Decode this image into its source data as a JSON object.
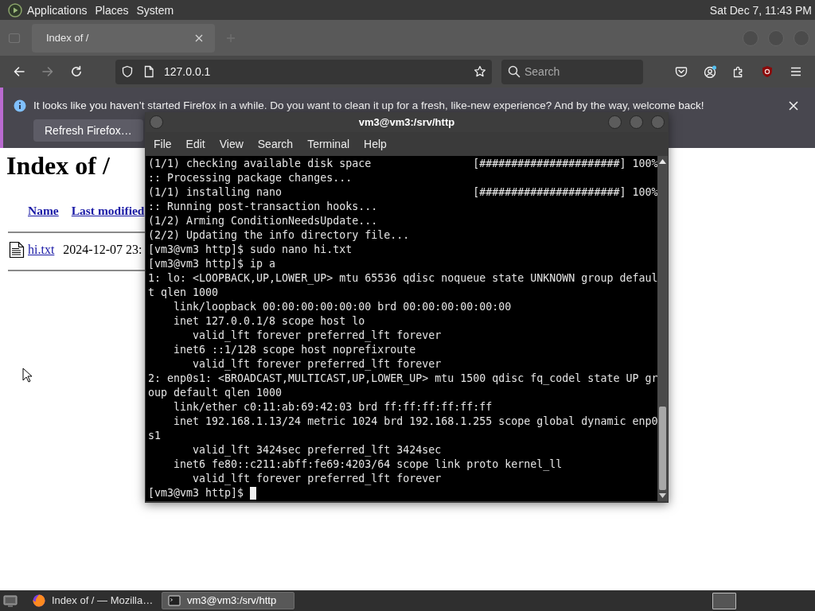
{
  "top_panel": {
    "menus": [
      "Applications",
      "Places",
      "System"
    ],
    "clock": "Sat Dec 7, 11:43 PM"
  },
  "browser": {
    "tabs": [
      {
        "title": "Index of /",
        "selected": true
      }
    ],
    "nav_buttons": [
      {
        "kind": "back",
        "disabled": false
      },
      {
        "kind": "forward",
        "disabled": true
      },
      {
        "kind": "reload",
        "disabled": false
      }
    ],
    "address": "127.0.0.1",
    "search": {
      "placeholder": "Search"
    },
    "notification": {
      "message": "It looks like you haven’t started Firefox in a while. Do you want to clean it up for a fresh, like-new experience? And by the way, welcome back!",
      "button": "Refresh Firefox…"
    },
    "page": {
      "heading": "Index of /",
      "columns": [
        "Name",
        "Last modified"
      ],
      "rows": [
        {
          "name": "hi.txt",
          "last_modified": "2024-12-07 23:"
        }
      ]
    }
  },
  "terminal": {
    "title": "vm3@vm3:/srv/http",
    "menus": [
      "File",
      "Edit",
      "View",
      "Search",
      "Terminal",
      "Help"
    ],
    "lines": [
      "(1/1) checking available disk space                [######################] 100%",
      ":: Processing package changes...",
      "(1/1) installing nano                              [######################] 100%",
      ":: Running post-transaction hooks...",
      "(1/2) Arming ConditionNeedsUpdate...",
      "(2/2) Updating the info directory file...",
      "[vm3@vm3 http]$ sudo nano hi.txt",
      "[vm3@vm3 http]$ ip a",
      "1: lo: <LOOPBACK,UP,LOWER_UP> mtu 65536 qdisc noqueue state UNKNOWN group defaul",
      "t qlen 1000",
      "    link/loopback 00:00:00:00:00:00 brd 00:00:00:00:00:00",
      "    inet 127.0.0.1/8 scope host lo",
      "       valid_lft forever preferred_lft forever",
      "    inet6 ::1/128 scope host noprefixroute",
      "       valid_lft forever preferred_lft forever",
      "2: enp0s1: <BROADCAST,MULTICAST,UP,LOWER_UP> mtu 1500 qdisc fq_codel state UP gr",
      "oup default qlen 1000",
      "    link/ether c0:11:ab:69:42:03 brd ff:ff:ff:ff:ff:ff",
      "    inet 192.168.1.13/24 metric 1024 brd 192.168.1.255 scope global dynamic enp0",
      "s1",
      "       valid_lft 3424sec preferred_lft 3424sec",
      "    inet6 fe80::c211:abff:fe69:4203/64 scope link proto kernel_ll",
      "       valid_lft forever preferred_lft forever",
      "[vm3@vm3 http]$"
    ],
    "cursor": true
  },
  "taskbar": {
    "items": [
      {
        "kind": "browser",
        "label": "Index of / — Mozilla…",
        "selected": false
      },
      {
        "kind": "terminal",
        "label": "vm3@vm3:/srv/http",
        "selected": true
      }
    ]
  }
}
